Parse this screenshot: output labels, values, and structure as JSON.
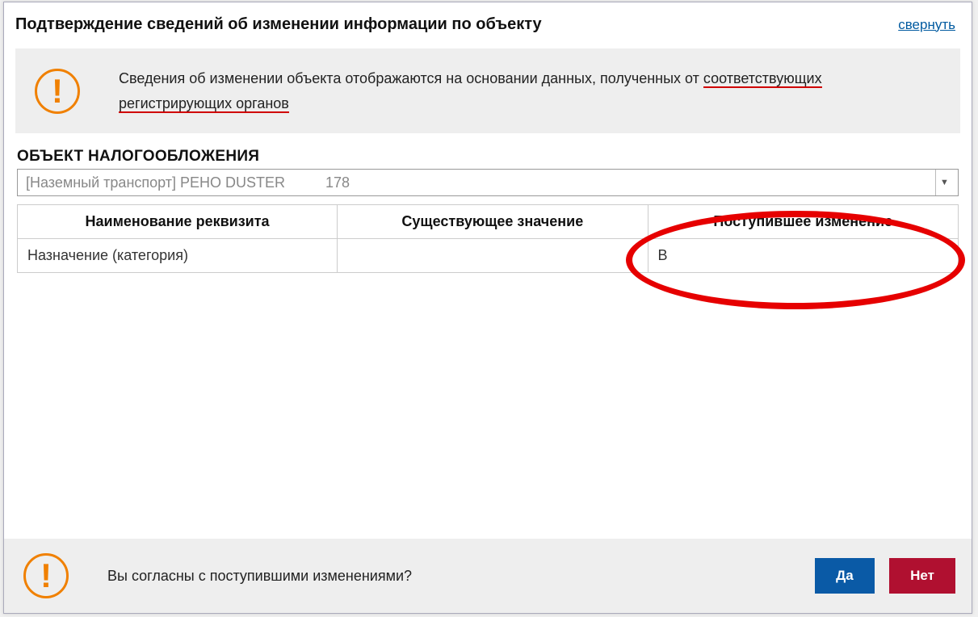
{
  "header": {
    "title": "Подтверждение сведений об изменении информации по объекту",
    "collapse": "свернуть"
  },
  "info": {
    "text_plain_prefix": "Сведения об изменении объекта отображаются на основании данных, полученных от ",
    "text_underlined_1": "соответствующих",
    "text_underlined_2": "регистрирующих органов"
  },
  "section": {
    "label": "ОБЪЕКТ НАЛОГООБЛОЖЕНИЯ",
    "select_value": "[Наземный транспорт] РЕНО DUSTER          178"
  },
  "table": {
    "columns": [
      "Наименование реквизита",
      "Существующее значение",
      "Поступившее изменение"
    ],
    "rows": [
      {
        "name": "Назначение (категория)",
        "existing": "",
        "incoming": "В"
      }
    ]
  },
  "footer": {
    "question": "Вы согласны с поступившими изменениями?",
    "yes": "Да",
    "no": "Нет"
  }
}
